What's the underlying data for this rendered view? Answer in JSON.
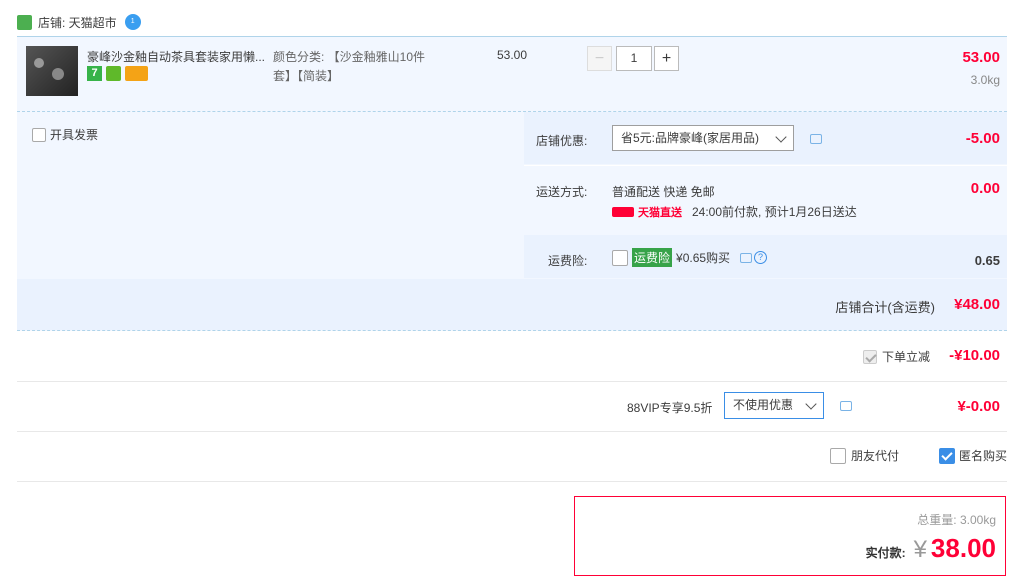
{
  "store": {
    "name": "店铺: 天猫超市",
    "badge": "1"
  },
  "item": {
    "title": "豪峰沙金釉自动茶具套装家用懒...",
    "sku_line1": "颜色分类: 【沙金釉雅山10件",
    "sku_line2": "套】【简装】",
    "unit_price": "53.00",
    "quantity": "1",
    "subtotal": "53.00",
    "weight": "3.0kg",
    "badge_seven": "7"
  },
  "invoice": {
    "label": "开具发票"
  },
  "discount": {
    "label": "店铺优惠:",
    "selected": "省5元:品牌豪峰(家居用品)",
    "amount": "-5.00"
  },
  "shipping": {
    "label": "运送方式:",
    "method": "普通配送 快递 免邮",
    "direct_badge": "天猫直送",
    "eta": "24:00前付款, 预计1月26日送达",
    "amount": "0.00"
  },
  "insurance": {
    "label": "运费险:",
    "tag": "运费险",
    "price": "¥0.65购买",
    "amount": "0.65"
  },
  "store_total": {
    "label": "店铺合计(含运费)",
    "amount": "¥48.00"
  },
  "instant": {
    "label": "下单立减",
    "amount": "-¥10.00"
  },
  "vip": {
    "label": "88VIP专享9.5折",
    "selected": "不使用优惠",
    "amount": "¥-0.00"
  },
  "options": {
    "friend_pay": "朋友代付",
    "anonymous": "匿名购买"
  },
  "summary": {
    "weight_label": "总重量:",
    "weight_value": "3.00kg",
    "pay_label": "实付款:",
    "currency": "¥",
    "pay_value": "38.00"
  },
  "colors": {
    "accent_red": "#ff0036",
    "panel_bg": "#f2f7ff",
    "brand_blue": "#3a8ee6"
  }
}
